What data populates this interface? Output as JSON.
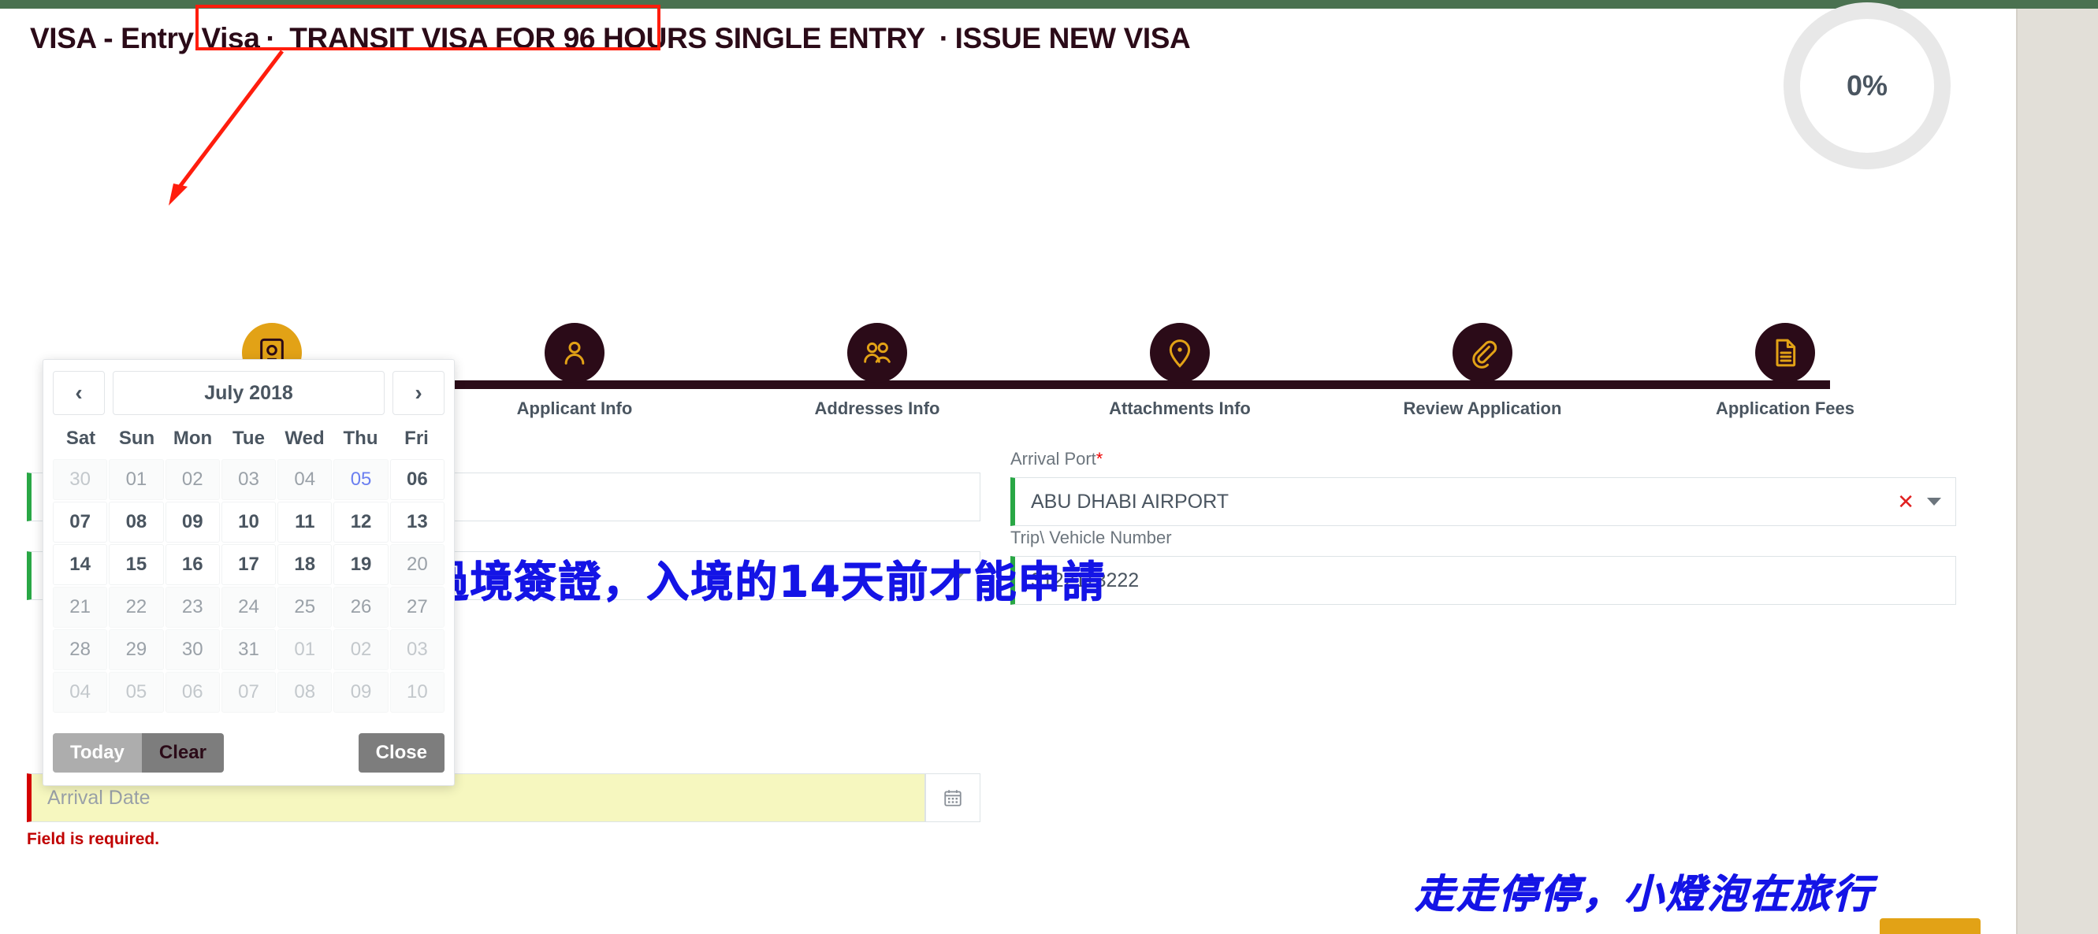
{
  "page": {
    "accent_dark": "#2b0b18",
    "accent_orange": "#e2a216",
    "topbar_green": "#4a7150",
    "right_rail_beige": "#e2dfd8",
    "callout_red": "#ff1d0d",
    "annotation_blue": "#1414e6"
  },
  "breadcrumb": {
    "part1": "VISA - Entry Visa",
    "sep1": "·",
    "part2": "TRANSIT VISA FOR 96 HOURS SINGLE ENTRY",
    "sep2": "·",
    "part3": "ISSUE NEW VISA"
  },
  "progress": {
    "percent_label": "0%",
    "value": 0
  },
  "stepper": {
    "steps": [
      {
        "label": "",
        "icon": "passport-icon",
        "state": "active"
      },
      {
        "label": "Applicant Info",
        "icon": "person-icon",
        "state": "pending"
      },
      {
        "label": "Addresses Info",
        "icon": "people-icon",
        "state": "pending"
      },
      {
        "label": "Attachments Info",
        "icon": "map-pin-icon",
        "state": "pending"
      },
      {
        "label": "Review Application",
        "icon": "paperclip-icon",
        "state": "pending"
      },
      {
        "label": "Application Fees",
        "icon": "document-icon",
        "state": "pending"
      }
    ]
  },
  "form": {
    "left_column": [
      {
        "name": "hidden-field-1",
        "label": "",
        "value": "",
        "placeholder": "",
        "type": "text",
        "valid": true
      },
      {
        "name": "hidden-field-2",
        "label": "",
        "value": "",
        "placeholder": "",
        "type": "select",
        "valid": true
      }
    ],
    "arrival_date": {
      "label": "",
      "placeholder": "Arrival Date",
      "value": "",
      "error": "Field is required.",
      "calendar_icon": "calendar-icon"
    },
    "arrival_port": {
      "label": "Arrival Port",
      "required_mark": "*",
      "value": "ABU DHABI AIRPORT",
      "clear_icon": "x-clear-icon",
      "caret_icon": "chevron-down-icon"
    },
    "trip_vehicle_number": {
      "label": "Trip\\ Vehicle Number",
      "value": "3122113222",
      "placeholder": ""
    }
  },
  "datepicker": {
    "prev_icon": "chevron-left-icon",
    "next_icon": "chevron-right-icon",
    "title": "July 2018",
    "dow": [
      "Sat",
      "Sun",
      "Mon",
      "Tue",
      "Wed",
      "Thu",
      "Fri"
    ],
    "weeks": [
      [
        {
          "d": "30",
          "state": "muted"
        },
        {
          "d": "01",
          "state": "dim"
        },
        {
          "d": "02",
          "state": "dim"
        },
        {
          "d": "03",
          "state": "dim"
        },
        {
          "d": "04",
          "state": "dim"
        },
        {
          "d": "05",
          "state": "today"
        },
        {
          "d": "06",
          "state": "normal"
        }
      ],
      [
        {
          "d": "07",
          "state": "normal"
        },
        {
          "d": "08",
          "state": "normal"
        },
        {
          "d": "09",
          "state": "normal"
        },
        {
          "d": "10",
          "state": "normal"
        },
        {
          "d": "11",
          "state": "normal"
        },
        {
          "d": "12",
          "state": "normal"
        },
        {
          "d": "13",
          "state": "normal"
        }
      ],
      [
        {
          "d": "14",
          "state": "normal"
        },
        {
          "d": "15",
          "state": "normal"
        },
        {
          "d": "16",
          "state": "normal"
        },
        {
          "d": "17",
          "state": "normal"
        },
        {
          "d": "18",
          "state": "normal"
        },
        {
          "d": "19",
          "state": "normal"
        },
        {
          "d": "20",
          "state": "dim"
        }
      ],
      [
        {
          "d": "21",
          "state": "dim"
        },
        {
          "d": "22",
          "state": "dim"
        },
        {
          "d": "23",
          "state": "dim"
        },
        {
          "d": "24",
          "state": "dim"
        },
        {
          "d": "25",
          "state": "dim"
        },
        {
          "d": "26",
          "state": "dim"
        },
        {
          "d": "27",
          "state": "dim"
        }
      ],
      [
        {
          "d": "28",
          "state": "dim"
        },
        {
          "d": "29",
          "state": "dim"
        },
        {
          "d": "30",
          "state": "dim"
        },
        {
          "d": "31",
          "state": "dim"
        },
        {
          "d": "01",
          "state": "muted"
        },
        {
          "d": "02",
          "state": "muted"
        },
        {
          "d": "03",
          "state": "muted"
        }
      ],
      [
        {
          "d": "04",
          "state": "muted"
        },
        {
          "d": "05",
          "state": "muted"
        },
        {
          "d": "06",
          "state": "muted"
        },
        {
          "d": "07",
          "state": "muted"
        },
        {
          "d": "08",
          "state": "muted"
        },
        {
          "d": "09",
          "state": "muted"
        },
        {
          "d": "10",
          "state": "muted"
        }
      ]
    ],
    "today_label": "Today",
    "clear_label": "Clear",
    "close_label": "Close"
  },
  "annotations": {
    "note_main": "過境簽證，入境的14天前才能申請",
    "watermark": "走走停停，小燈泡在旅行"
  }
}
